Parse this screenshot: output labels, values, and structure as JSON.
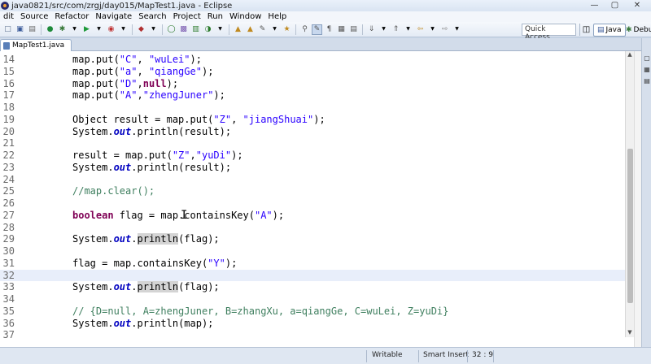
{
  "window": {
    "title": "java0821/src/com/zrgj/day015/MapTest1.java - Eclipse"
  },
  "menubar": {
    "items": [
      "dit",
      "Source",
      "Refactor",
      "Navigate",
      "Search",
      "Project",
      "Run",
      "Window",
      "Help"
    ]
  },
  "toolbar": {
    "quick_access_placeholder": "Quick Access",
    "perspective_java": "Java",
    "perspective_debug": "Debug"
  },
  "editor": {
    "tab_label": "MapTest1.java",
    "current_line": 32,
    "lines": [
      {
        "n": "14",
        "html": "map.put(<span class=\"s\">\"C\"</span>, <span class=\"s\">\"wuLei\"</span>);"
      },
      {
        "n": "15",
        "html": "map.put(<span class=\"s\">\"a\"</span>, <span class=\"s\">\"qiangGe\"</span>);"
      },
      {
        "n": "16",
        "html": "map.put(<span class=\"s\">\"D\"</span>,<span class=\"k\">null</span>);"
      },
      {
        "n": "17",
        "html": "map.put(<span class=\"s\">\"A\"</span>,<span class=\"s\">\"zhengJuner\"</span>);"
      },
      {
        "n": "18",
        "html": ""
      },
      {
        "n": "19",
        "html": "Object result = map.put(<span class=\"s\">\"Z\"</span>, <span class=\"s\">\"jiangShuai\"</span>);"
      },
      {
        "n": "20",
        "html": "System.<span class=\"f\">out</span>.println(result);"
      },
      {
        "n": "21",
        "html": ""
      },
      {
        "n": "22",
        "html": "result = map.put(<span class=\"s\">\"Z\"</span>,<span class=\"s\">\"yuDi\"</span>);"
      },
      {
        "n": "23",
        "html": "System.<span class=\"f\">out</span>.println(result);"
      },
      {
        "n": "24",
        "html": ""
      },
      {
        "n": "25",
        "html": "<span class=\"c\">//map.clear();</span>"
      },
      {
        "n": "26",
        "html": ""
      },
      {
        "n": "27",
        "html": "<span class=\"k\">boolean</span> flag = map.containsKey(<span class=\"s\">\"A\"</span>);"
      },
      {
        "n": "28",
        "html": ""
      },
      {
        "n": "29",
        "html": "System.<span class=\"f\">out</span>.<span class=\"occ\">println</span>(flag);"
      },
      {
        "n": "30",
        "html": ""
      },
      {
        "n": "31",
        "html": "flag = map.containsKey(<span class=\"s\">\"Y\"</span>);"
      },
      {
        "n": "32",
        "html": ""
      },
      {
        "n": "33",
        "html": "System.<span class=\"f\">out</span>.<span class=\"occ\">println</span>(flag);"
      },
      {
        "n": "34",
        "html": ""
      },
      {
        "n": "35",
        "html": "<span class=\"c\">// {D=null, A=zhengJuner, B=zhangXu, a=qiangGe, C=wuLei, Z=yuDi}</span>"
      },
      {
        "n": "36",
        "html": "System.<span class=\"f\">out</span>.println(map);"
      },
      {
        "n": "37",
        "html": ""
      }
    ]
  },
  "statusbar": {
    "mode": "Writable",
    "insert": "Smart Insert",
    "position": "32 : 9"
  },
  "colors": {
    "keyword": "#7f0055",
    "string": "#2a00ff",
    "comment": "#3f7f5f",
    "field": "#0000c0",
    "current_line": "#e8eefa"
  }
}
